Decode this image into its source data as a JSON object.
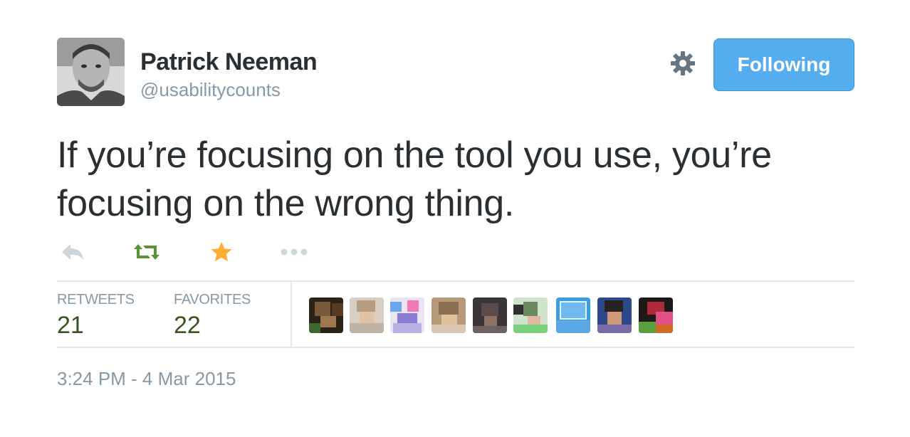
{
  "user": {
    "fullname": "Patrick Neeman",
    "username": "@usabilitycounts"
  },
  "follow_button": {
    "label": "Following"
  },
  "tweet": {
    "text": "If you’re focusing on the tool you use, you’re focusing on the wrong thing."
  },
  "actions": {
    "reply_icon": "reply-icon",
    "retweet_icon": "retweet-icon",
    "favorite_icon": "star-icon",
    "more_icon": "more-dots-icon"
  },
  "stats": {
    "retweets": {
      "label": "RETWEETS",
      "value": "21"
    },
    "favorites": {
      "label": "FAVORITES",
      "value": "22"
    }
  },
  "favoriters_count_shown": 9,
  "timestamp": "3:24 PM - 4 Mar 2015",
  "colors": {
    "accent": "#55acee",
    "retweet_green": "#5c913b",
    "favorite_gold": "#ffac33",
    "muted": "#8899a6",
    "text": "#292f33"
  }
}
